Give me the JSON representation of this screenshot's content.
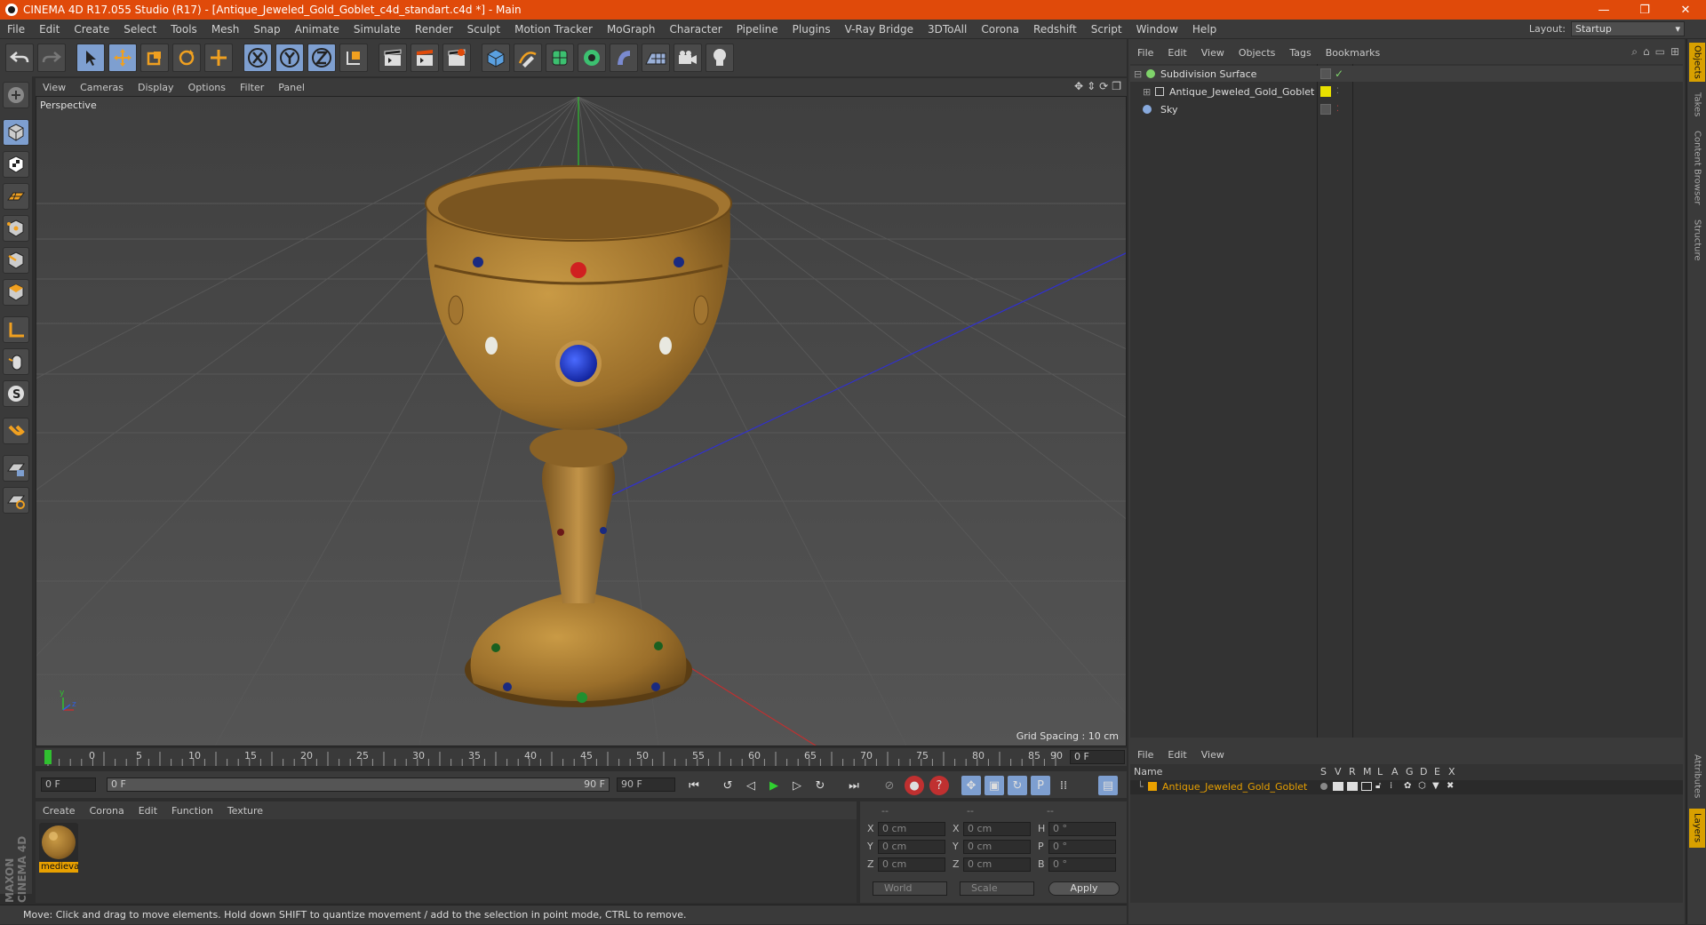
{
  "window": {
    "title": "CINEMA 4D R17.055 Studio (R17) - [Antique_Jeweled_Gold_Goblet_c4d_standart.c4d *] - Main",
    "controls": [
      "—",
      "❐",
      "✕"
    ]
  },
  "menubar": {
    "items": [
      "File",
      "Edit",
      "Create",
      "Select",
      "Tools",
      "Mesh",
      "Snap",
      "Animate",
      "Simulate",
      "Render",
      "Sculpt",
      "Motion Tracker",
      "MoGraph",
      "Character",
      "Pipeline",
      "Plugins",
      "V-Ray Bridge",
      "3DToAll",
      "Corona",
      "Redshift",
      "Script",
      "Window",
      "Help"
    ],
    "layout_label": "Layout:",
    "layout_value": "Startup"
  },
  "viewport": {
    "menu": [
      "View",
      "Cameras",
      "Display",
      "Options",
      "Filter",
      "Panel"
    ],
    "label": "Perspective",
    "grid_spacing": "Grid Spacing : 10 cm"
  },
  "timeline": {
    "ticks": [
      "0",
      "5",
      "10",
      "15",
      "20",
      "25",
      "30",
      "35",
      "40",
      "45",
      "50",
      "55",
      "60",
      "65",
      "70",
      "75",
      "80",
      "85",
      "90"
    ],
    "current_frame": "0 F",
    "start_field": "0 F",
    "range_start": "0 F",
    "range_end": "90 F",
    "end_field": "90 F"
  },
  "materials": {
    "menu": [
      "Create",
      "Corona",
      "Edit",
      "Function",
      "Texture"
    ],
    "items": [
      {
        "label": "medieva"
      }
    ]
  },
  "coordinates": {
    "headers": [
      "--",
      "--",
      "--"
    ],
    "rows": [
      {
        "axis": "X",
        "pos": "0 cm",
        "axis2": "X",
        "size": "0 cm",
        "axis3": "H",
        "rot": "0 °"
      },
      {
        "axis": "Y",
        "pos": "0 cm",
        "axis2": "Y",
        "size": "0 cm",
        "axis3": "P",
        "rot": "0 °"
      },
      {
        "axis": "Z",
        "pos": "0 cm",
        "axis2": "Z",
        "size": "0 cm",
        "axis3": "B",
        "rot": "0 °"
      }
    ],
    "mode1": "World",
    "mode2": "Scale",
    "apply": "Apply"
  },
  "status": "Move: Click and drag to move elements. Hold down SHIFT to quantize movement / add to the selection in point mode, CTRL to remove.",
  "objects": {
    "menu": [
      "File",
      "Edit",
      "View",
      "Objects",
      "Tags",
      "Bookmarks"
    ],
    "items": [
      {
        "name": "Subdivision Surface",
        "color": "#7fd36a"
      },
      {
        "name": "Antique_Jeweled_Gold_Goblet",
        "color": "#e8e000"
      },
      {
        "name": "Sky",
        "color": "#88aadd"
      }
    ]
  },
  "layers": {
    "menu": [
      "File",
      "Edit",
      "View"
    ],
    "header_name": "Name",
    "header_cols": [
      "S",
      "V",
      "R",
      "M",
      "L",
      "A",
      "G",
      "D",
      "E",
      "X"
    ],
    "row_name": "Antique_Jeweled_Gold_Goblet",
    "row_color": "#e8a000"
  },
  "side_tabs": [
    "Objects",
    "Takes",
    "Content Browser",
    "Structure",
    "Attributes",
    "Layers"
  ],
  "logo": "MAXON CINEMA 4D",
  "colors": {
    "title_bar": "#e04a0a",
    "selected_tool": "#7e9fd0",
    "accent": "#e8a000"
  }
}
